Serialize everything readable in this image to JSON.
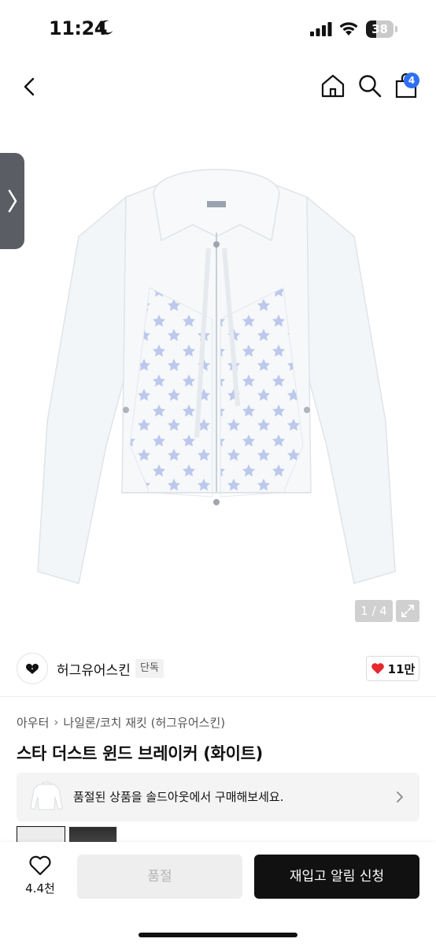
{
  "status_bar": {
    "time": "11:24",
    "battery_level": "38",
    "battery_fraction": 0.38
  },
  "nav": {
    "cart_count": "4"
  },
  "gallery": {
    "counter": "1 / 4"
  },
  "brand": {
    "name": "허그유어스킨",
    "badge": "단독",
    "like_count": "11만"
  },
  "product": {
    "breadcrumb": [
      "아우터",
      "나일론/코치 재킷 (허그유어스킨)"
    ],
    "breadcrumb_separator": "›",
    "title": "스타 더스트 윈드 브레이커 (화이트)"
  },
  "soldout_banner": {
    "text": "품절된 상품을 솔드아웃에서 구매해보세요."
  },
  "bottom_bar": {
    "wish_count": "4.4천",
    "buy_label": "품절",
    "restock_label": "재입고 알림 신청"
  },
  "colors": {
    "accent_blue": "#2f6ff2",
    "heart_red": "#e8272e",
    "primary_button": "#111111",
    "disabled_button": "#eeeeee"
  },
  "icons": {
    "back": "chevron-left-icon",
    "home": "home-icon",
    "search": "search-icon",
    "cart": "shopping-bag-icon",
    "expand": "expand-icon",
    "like": "heart-icon",
    "wish": "heart-outline-icon"
  }
}
